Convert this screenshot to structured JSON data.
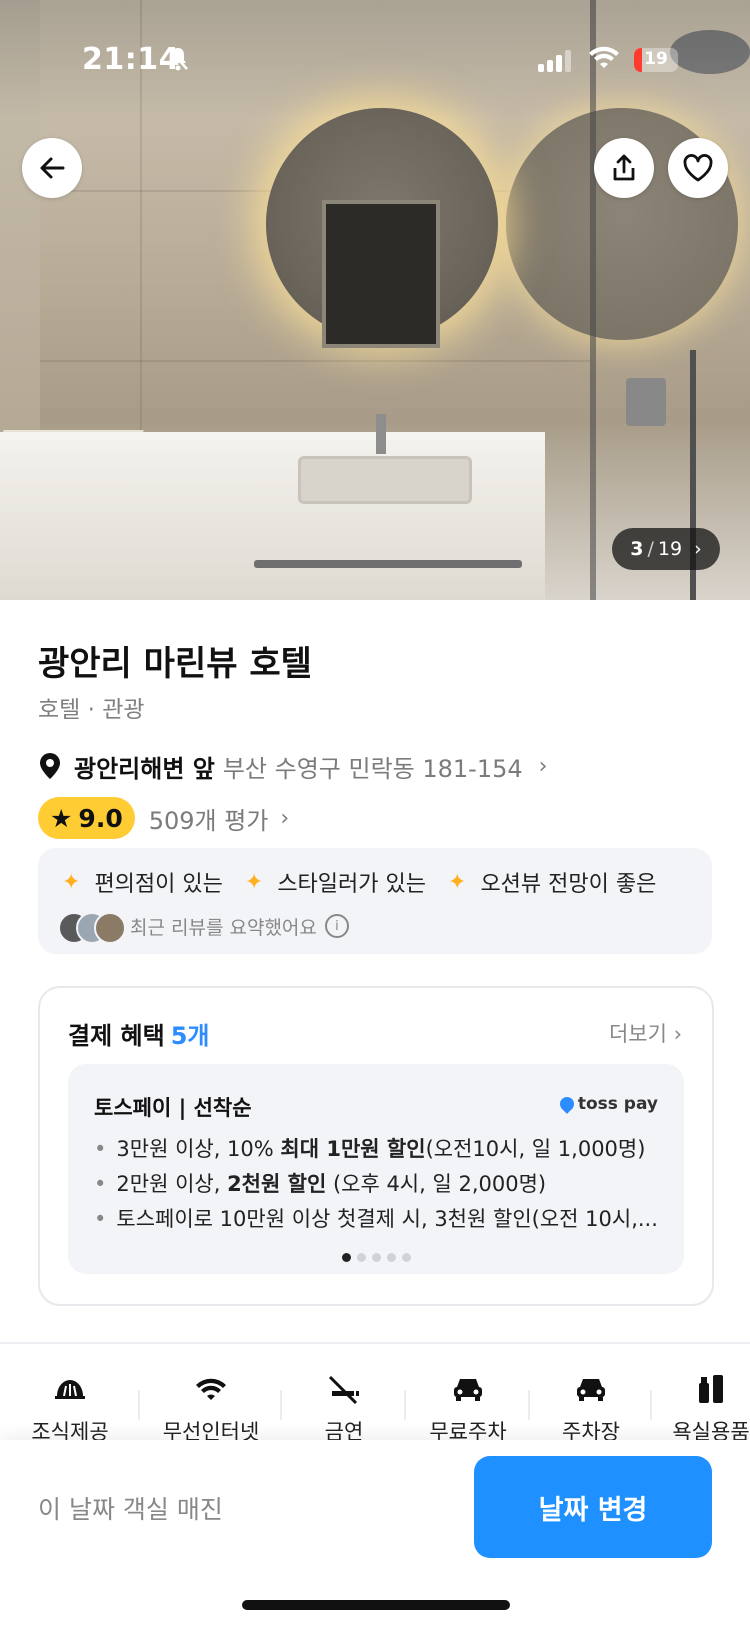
{
  "status_bar": {
    "time": "21:14",
    "battery": "19"
  },
  "gallery": {
    "current": "3",
    "separator": "/",
    "total": "19"
  },
  "hotel": {
    "name": "광안리 마린뷰 호텔",
    "category": "호텔 · 관광",
    "location_highlight": "광안리해변 앞",
    "address": "부산 수영구 민락동 181-154",
    "rating": "9.0",
    "review_count": "509개 평가"
  },
  "review_summary": {
    "tags": [
      "편의점이 있는",
      "스타일러가 있는",
      "오션뷰 전망이 좋은"
    ],
    "note": "최근 리뷰를 요약했어요"
  },
  "payment_benefits": {
    "title": "결제 혜택",
    "count": "5개",
    "more": "더보기",
    "card": {
      "title": "토스페이 | 선착순",
      "brand": "toss pay",
      "lines": [
        {
          "pre": "3만원 이상, 10% ",
          "bold": "최대 1만원 할인",
          "post": "(오전10시, 일 1,000명)"
        },
        {
          "pre": "2만원 이상, ",
          "bold": "2천원 할인",
          "post": " (오후 4시, 일 2,000명)"
        },
        {
          "pre": "토스페이로 10만원 이상 첫결제 시, 3천원 할인(오전 10시,...",
          "bold": "",
          "post": ""
        }
      ]
    }
  },
  "amenities": [
    {
      "label": "조식제공",
      "icon": "breakfast-icon"
    },
    {
      "label": "무선인터넷",
      "icon": "wifi-icon"
    },
    {
      "label": "금연",
      "icon": "no-smoking-icon"
    },
    {
      "label": "무료주차",
      "icon": "car-icon"
    },
    {
      "label": "주차장",
      "icon": "car-icon"
    },
    {
      "label": "욕실용품",
      "icon": "toiletries-icon"
    }
  ],
  "bottom_bar": {
    "sold_out": "이 날짜 객실 매진",
    "change_date": "날짜 변경"
  },
  "colors": {
    "accent": "#1e90ff",
    "rating": "#ffcc33",
    "sparkle": "#ffb020",
    "link_blue": "#2d8cff"
  }
}
